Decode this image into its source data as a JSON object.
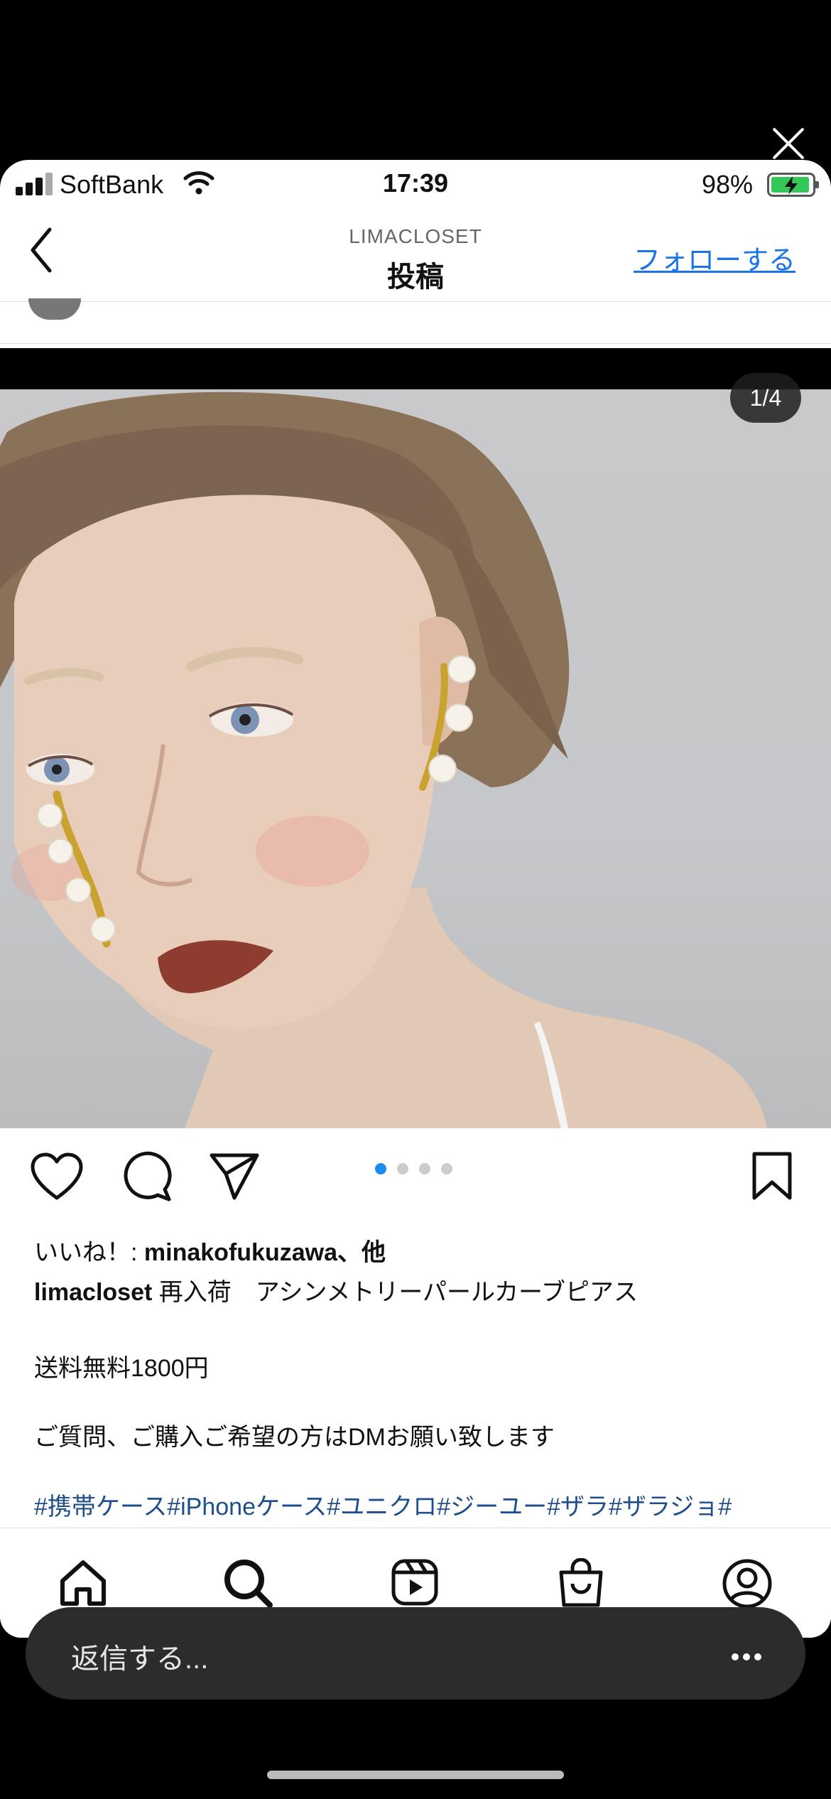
{
  "status_bar": {
    "carrier": "SoftBank",
    "time": "17:39",
    "battery_percent": "98%"
  },
  "header": {
    "account": "LIMACLOSET",
    "title": "投稿",
    "follow_label": "フォローする"
  },
  "media": {
    "counter": "1/4",
    "page_dots": 4,
    "active_dot": 0
  },
  "post": {
    "likes_prefix": "いいね！: ",
    "likes_user": "minakofukuzawa",
    "likes_suffix": "、他",
    "username": "limacloset",
    "caption_line1": " 再入荷　アシンメトリーパールカーブピアス",
    "caption_line2": "送料無料1800円",
    "caption_line3": "ご質問、ご購入ご希望の方はDMお願い致します",
    "hashtags": "#携帯ケース#iPhoneケース#ユニクロ#ジーユー#ザラ#ザラジョ#"
  },
  "reply": {
    "placeholder": "返信する..."
  },
  "colors": {
    "accent": "#1a73e8",
    "hashtag": "#1f4e8c",
    "active_dot": "#1a8cf0",
    "battery": "#34c759"
  },
  "icons": [
    "close-icon",
    "signal-icon",
    "wifi-icon",
    "battery-icon",
    "back-chevron-icon",
    "heart-icon",
    "comment-icon",
    "share-icon",
    "bookmark-icon",
    "home-icon",
    "search-icon",
    "reels-icon",
    "shop-icon",
    "profile-icon",
    "more-icon"
  ]
}
